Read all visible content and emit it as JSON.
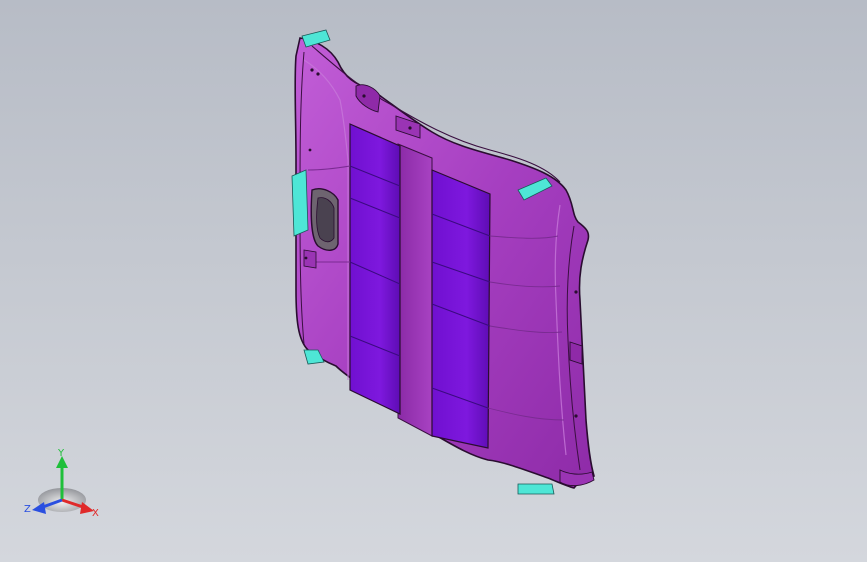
{
  "viewport": {
    "background_top": "#b7bcc6",
    "background_bottom": "#d4d7dd"
  },
  "model": {
    "part": "headliner",
    "colors": {
      "body": "#a53fc0",
      "body_dark": "#7c2496",
      "body_light": "#c15fd6",
      "panel": "#7a10d8",
      "panel_dark": "#5d0bb0",
      "clip": "#4ee6d6",
      "edge": "#2a0d30"
    },
    "icons": [
      "cyan-clip-icon",
      "sunroof-opening-icon"
    ]
  },
  "triad": {
    "y_label": "Y",
    "z_label": "Z",
    "x_label": "X",
    "y_color": "#1fbf3a",
    "z_color": "#2a4fe0",
    "x_color": "#e02a2a"
  }
}
